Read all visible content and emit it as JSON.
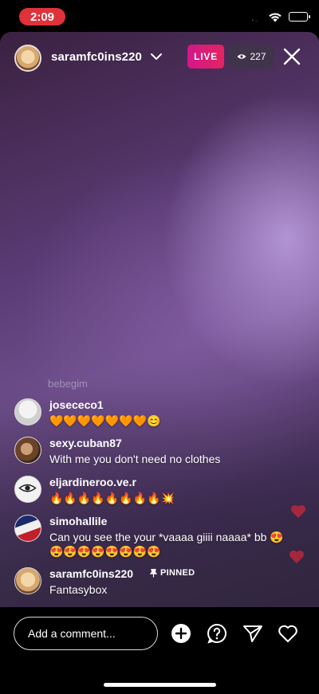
{
  "status_bar": {
    "time": "2:09",
    "carrier": "• ... "
  },
  "header": {
    "host_username": "saramfc0ins220",
    "live_label": "LIVE",
    "viewer_count": "227"
  },
  "comments": {
    "faded": "bebegim",
    "items": [
      {
        "username": "josececo1",
        "text": "🧡🧡🧡🧡🧡🧡🧡😊"
      },
      {
        "username": "sexy.cuban87",
        "text": "With me you don't need no clothes"
      },
      {
        "username": "eljardineroo.ve.r",
        "text": "🔥🔥🔥🔥🔥🔥🔥🔥💥"
      },
      {
        "username": "simohallile",
        "text": "Can you see the your *vaaaa giiii naaaa* bb 😍😍😍😍😍😍😍😍😍"
      },
      {
        "username": "saramfc0ins220",
        "text": "Fantasybox",
        "tag": "PINNED"
      }
    ]
  },
  "bottom_bar": {
    "comment_placeholder": "Add a comment..."
  },
  "colors": {
    "live": "#e4245f",
    "status_pill": "#e0323a"
  },
  "icons": [
    "wifi-icon",
    "battery-icon",
    "chevron-down-icon",
    "eye-icon",
    "close-icon",
    "pin-icon",
    "add-circle-icon",
    "question-icon",
    "send-icon",
    "heart-icon"
  ]
}
